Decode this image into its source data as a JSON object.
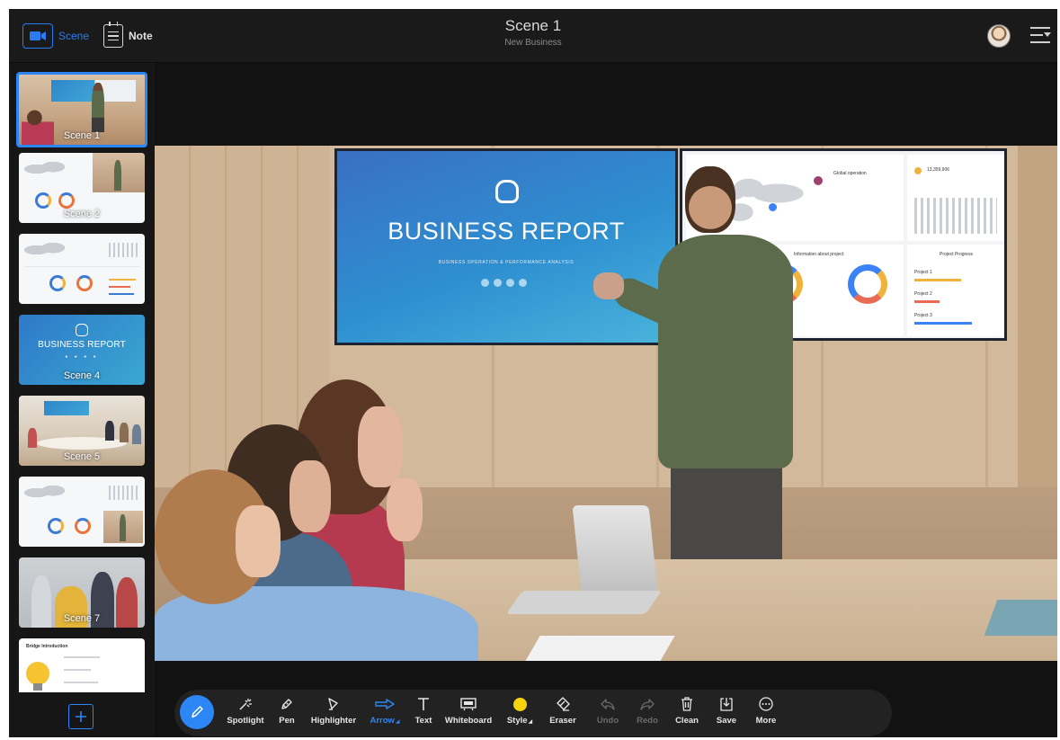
{
  "header": {
    "scene_mode_label": "Scene",
    "note_mode_label": "Note",
    "title": "Scene 1",
    "subtitle": "New Business",
    "avatar_icon": "user-avatar",
    "menu_icon": "menu-dropdown-icon",
    "accent_color": "#2c86f5"
  },
  "sidebar": {
    "scenes": [
      {
        "label": "Scene 1",
        "active": true
      },
      {
        "label": "Scene 2"
      },
      {
        "label": ""
      },
      {
        "label": "Scene 4",
        "preview_title": "BUSINESS REPORT"
      },
      {
        "label": "Scene 5"
      },
      {
        "label": ""
      },
      {
        "label": "Scene 7"
      },
      {
        "label": "",
        "preview_heading": "Bridge Introduction"
      }
    ],
    "add_scene_icon": "plus-icon"
  },
  "stage": {
    "screen_title": "BUSINESS REPORT",
    "screen_subtitle": "BUSINESS OPERATION & PERFORMANCE ANALYSIS",
    "dashboard": {
      "panel1_title": "Global operation",
      "panel2_value": "13,359,906",
      "panel3_title": "Information about project",
      "panel4_title": "Project Progress",
      "project_labels": [
        "Project 1",
        "Project 2",
        "Project 3"
      ]
    }
  },
  "toolbar": {
    "tools": [
      {
        "label": "Spotlight",
        "icon": "spotlight-icon"
      },
      {
        "label": "Pen",
        "icon": "pen-icon"
      },
      {
        "label": "Highlighter",
        "icon": "highlighter-icon"
      },
      {
        "label": "Arrow",
        "icon": "arrow-icon",
        "selected": true,
        "has_menu": true
      },
      {
        "label": "Text",
        "icon": "text-icon"
      },
      {
        "label": "Whiteboard",
        "icon": "whiteboard-icon"
      },
      {
        "label": "Style",
        "icon": "style-color-icon",
        "has_menu": true,
        "color": "#f7d20e"
      },
      {
        "label": "Eraser",
        "icon": "eraser-icon"
      },
      {
        "label": "Undo",
        "icon": "undo-icon",
        "disabled": true
      },
      {
        "label": "Redo",
        "icon": "redo-icon",
        "disabled": true
      },
      {
        "label": "Clean",
        "icon": "trash-icon"
      },
      {
        "label": "Save",
        "icon": "save-icon"
      },
      {
        "label": "More",
        "icon": "more-icon"
      }
    ]
  }
}
